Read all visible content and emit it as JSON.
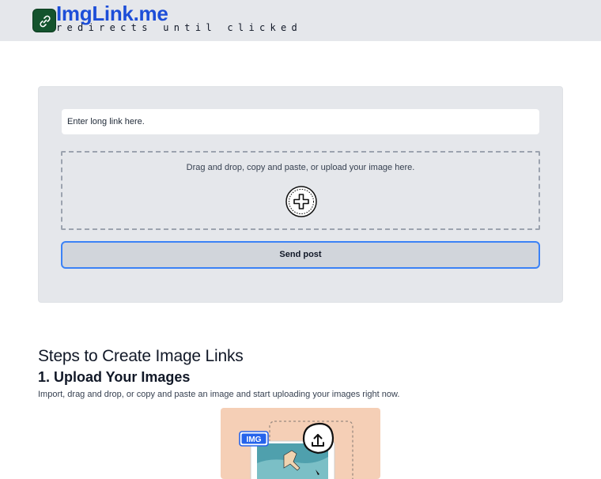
{
  "header": {
    "brand_name": "ImgLink.me",
    "tagline": "redirects until clicked",
    "logo_icon": "link-icon",
    "colors": {
      "brand": "#1d4ed8",
      "logo_bg": "#14532d",
      "bar_bg": "#e5e7eb"
    }
  },
  "form": {
    "link_input": {
      "placeholder": "Enter long link here.",
      "value": ""
    },
    "dropzone": {
      "text": "Drag and drop, copy and paste, or upload your image here.",
      "icon": "plus-circle-icon"
    },
    "submit_label": "Send post",
    "colors": {
      "submit_border": "#3b82f6",
      "submit_bg": "#d1d5db"
    }
  },
  "steps": {
    "heading": "Steps to Create Image Links",
    "step1": {
      "title": "1. Upload Your Images",
      "description": "Import, drag and drop, or copy and paste an image and start uploading your images right now.",
      "illustration": {
        "badge": "IMG",
        "icon": "upload-icon",
        "bg": "#f5cfb6"
      }
    }
  }
}
